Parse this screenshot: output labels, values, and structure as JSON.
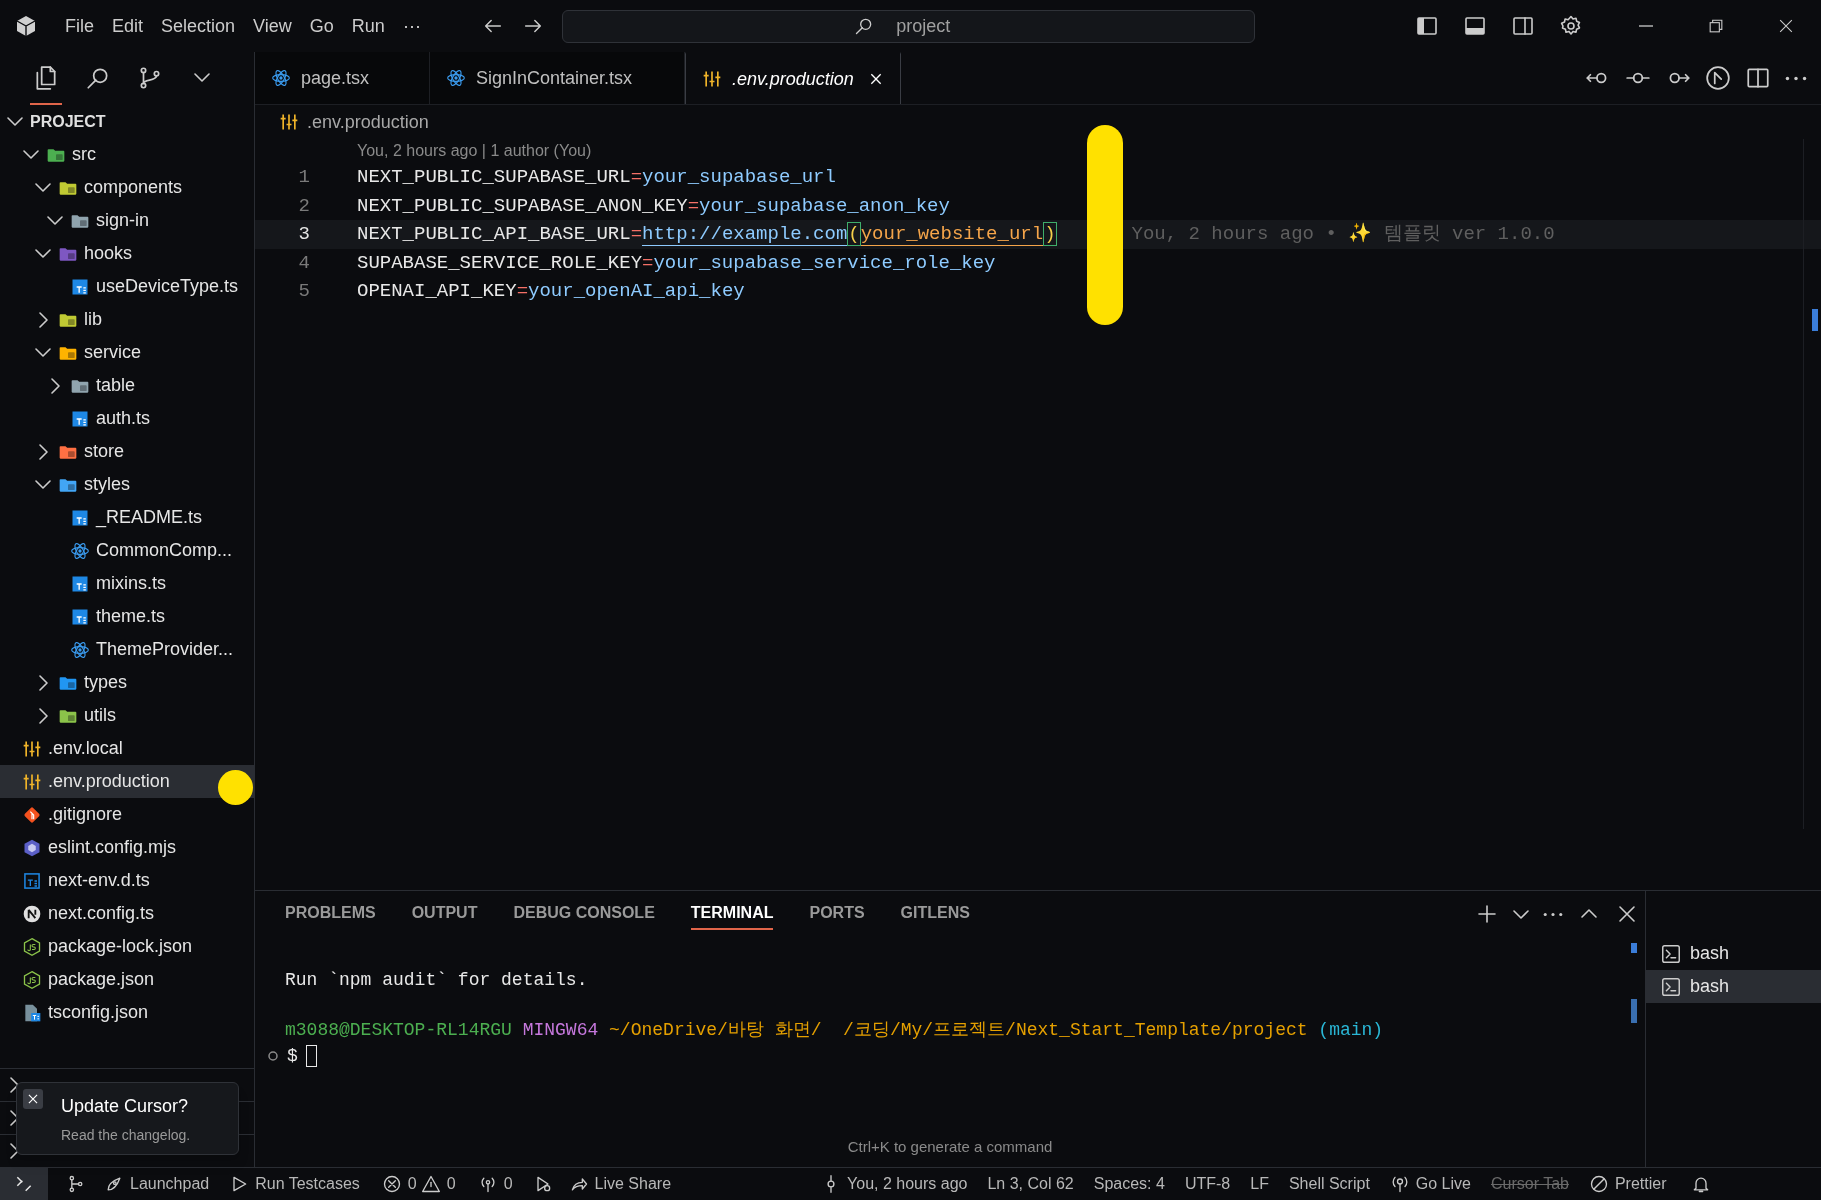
{
  "menu": [
    "File",
    "Edit",
    "Selection",
    "View",
    "Go",
    "Run",
    "⋯"
  ],
  "command_center": {
    "placeholder": "project"
  },
  "activity": [
    {
      "kind": "files",
      "selected": true
    },
    {
      "kind": "search",
      "selected": false
    },
    {
      "kind": "branch",
      "selected": false
    },
    {
      "kind": "chevron",
      "selected": false
    }
  ],
  "tabs": [
    {
      "label": "page.tsx",
      "kind": "react",
      "selected": false
    },
    {
      "label": "SignInContainer.tsx",
      "kind": "react",
      "selected": false
    },
    {
      "label": ".env.production",
      "kind": "env",
      "selected": true
    }
  ],
  "explorer": {
    "title": "PROJECT",
    "items": [
      {
        "label": "src",
        "kind": "folder",
        "color": "#4caf50",
        "expanded": true,
        "selected": false,
        "children": [
          {
            "label": "components",
            "kind": "folder",
            "color": "#c0ca33",
            "expanded": true,
            "selected": false,
            "children": [
              {
                "label": "sign-in",
                "kind": "folder",
                "color": "#90a4ae",
                "expanded": true,
                "selected": false
              }
            ]
          },
          {
            "label": "hooks",
            "kind": "folder",
            "color": "#7e57c2",
            "expanded": true,
            "selected": false,
            "children": [
              {
                "label": "useDeviceType.ts",
                "kind": "ts",
                "selected": false
              }
            ]
          },
          {
            "label": "lib",
            "kind": "folder",
            "color": "#c0ca33",
            "expanded": false,
            "selected": false
          },
          {
            "label": "service",
            "kind": "folder",
            "color": "#ffb300",
            "expanded": true,
            "selected": false,
            "children": [
              {
                "label": "table",
                "kind": "folder",
                "color": "#90a4ae",
                "expanded": false,
                "selected": false
              },
              {
                "label": "auth.ts",
                "kind": "ts",
                "selected": false
              }
            ]
          },
          {
            "label": "store",
            "kind": "folder",
            "color": "#ff7043",
            "expanded": false,
            "selected": false
          },
          {
            "label": "styles",
            "kind": "folder",
            "color": "#42a5f5",
            "expanded": true,
            "selected": false,
            "children": [
              {
                "label": "_README.ts",
                "kind": "ts",
                "selected": false
              },
              {
                "label": "CommonComp...",
                "kind": "react",
                "selected": false
              },
              {
                "label": "mixins.ts",
                "kind": "ts",
                "selected": false
              },
              {
                "label": "theme.ts",
                "kind": "ts",
                "selected": false
              },
              {
                "label": "ThemeProvider...",
                "kind": "react",
                "selected": false
              }
            ]
          },
          {
            "label": "types",
            "kind": "folder",
            "color": "#2196f3",
            "expanded": false,
            "selected": false
          },
          {
            "label": "utils",
            "kind": "folder",
            "color": "#8bc34a",
            "expanded": false,
            "selected": false
          }
        ]
      },
      {
        "label": ".env.local",
        "kind": "env",
        "selected": false
      },
      {
        "label": ".env.production",
        "kind": "env",
        "selected": true
      },
      {
        "label": ".gitignore",
        "kind": "git",
        "selected": false
      },
      {
        "label": "eslint.config.mjs",
        "kind": "eslint",
        "selected": false
      },
      {
        "label": "next-env.d.ts",
        "kind": "tsd",
        "selected": false
      },
      {
        "label": "next.config.ts",
        "kind": "next",
        "selected": false
      },
      {
        "label": "package-lock.json",
        "kind": "node",
        "selected": false
      },
      {
        "label": "package.json",
        "kind": "node",
        "selected": false
      },
      {
        "label": "tsconfig.json",
        "kind": "tsconfig",
        "selected": false
      }
    ]
  },
  "breadcrumb": ".env.production",
  "blame_header": "You, 2 hours ago | 1 author (You)",
  "code_lines": [
    {
      "number": "1",
      "selected": false,
      "tokens": [
        {
          "kind": "key",
          "text": "NEXT_PUBLIC_SUPABASE_URL"
        },
        {
          "kind": "op",
          "text": "="
        },
        {
          "kind": "value",
          "text": "your_supabase_url"
        }
      ]
    },
    {
      "number": "2",
      "selected": false,
      "tokens": [
        {
          "kind": "key",
          "text": "NEXT_PUBLIC_SUPABASE_ANON_KEY"
        },
        {
          "kind": "op",
          "text": "="
        },
        {
          "kind": "value",
          "text": "your_supabase_anon_key"
        }
      ]
    },
    {
      "number": "3",
      "selected": true,
      "blame": "You, 2 hours ago • ✨ 템플릿 ver 1.0.0",
      "tokens": [
        {
          "kind": "key",
          "text": "NEXT_PUBLIC_API_BASE_URL"
        },
        {
          "kind": "op",
          "text": "="
        },
        {
          "kind": "link",
          "text": "http://example.com"
        },
        {
          "kind": "bracket",
          "text": "("
        },
        {
          "kind": "string",
          "text": "your_website_url"
        },
        {
          "kind": "bracket",
          "text": ")"
        }
      ]
    },
    {
      "number": "4",
      "selected": false,
      "tokens": [
        {
          "kind": "key",
          "text": "SUPABASE_SERVICE_ROLE_KEY"
        },
        {
          "kind": "op",
          "text": "="
        },
        {
          "kind": "value",
          "text": "your_supabase_service_role_key"
        }
      ]
    },
    {
      "number": "5",
      "selected": false,
      "tokens": [
        {
          "kind": "key",
          "text": "OPENAI_API_KEY"
        },
        {
          "kind": "op",
          "text": "="
        },
        {
          "kind": "value",
          "text": "your_openAI_api_key"
        }
      ]
    }
  ],
  "panel_tabs": [
    {
      "label": "PROBLEMS",
      "selected": false
    },
    {
      "label": "OUTPUT",
      "selected": false
    },
    {
      "label": "DEBUG CONSOLE",
      "selected": false
    },
    {
      "label": "TERMINAL",
      "selected": true
    },
    {
      "label": "PORTS",
      "selected": false
    },
    {
      "label": "GITLENS",
      "selected": false
    }
  ],
  "terminal": {
    "output": "Run `npm audit` for details.",
    "prompt": [
      {
        "kind": "user",
        "text": "m3088@DESKTOP-RL14RGU"
      },
      {
        "kind": "shell",
        "text": "MINGW64"
      },
      {
        "kind": "path",
        "text": "~/OneDrive/바탕 화면/  /코딩/My/프로젝트/Next_Start_Template/project"
      },
      {
        "kind": "branch",
        "text": "(main)"
      }
    ],
    "input": "$",
    "hint": "Ctrl+K to generate a command"
  },
  "terminal_list": [
    {
      "label": "bash",
      "selected": false
    },
    {
      "label": "bash",
      "selected": true
    }
  ],
  "notification": {
    "title": "Update Cursor?",
    "message": "Read the changelog."
  },
  "status_bar": [
    {
      "kind": "remote"
    },
    {
      "kind": "graph"
    },
    {
      "kind": "rocket",
      "text": "Launchpad"
    },
    {
      "kind": "play",
      "text": "Run Testcases"
    },
    {
      "kind": "errors",
      "text": "0"
    },
    {
      "kind": "warnings",
      "text": "0"
    },
    {
      "kind": "broadcast",
      "text": "0"
    },
    {
      "kind": "debug"
    },
    {
      "kind": "share",
      "text": "Live Share"
    },
    {
      "kind": "commit",
      "text": "You, 2 hours ago"
    },
    {
      "kind": "text",
      "text": "Ln 3, Col 62"
    },
    {
      "kind": "text",
      "text": "Spaces: 4"
    },
    {
      "kind": "text",
      "text": "UTF-8"
    },
    {
      "kind": "text",
      "text": "LF"
    },
    {
      "kind": "text",
      "text": "Shell Script"
    },
    {
      "kind": "golive",
      "text": "Go Live"
    },
    {
      "kind": "struck",
      "text": "Cursor Tab"
    },
    {
      "kind": "prettier",
      "text": "Prettier"
    },
    {
      "kind": "bell"
    }
  ]
}
